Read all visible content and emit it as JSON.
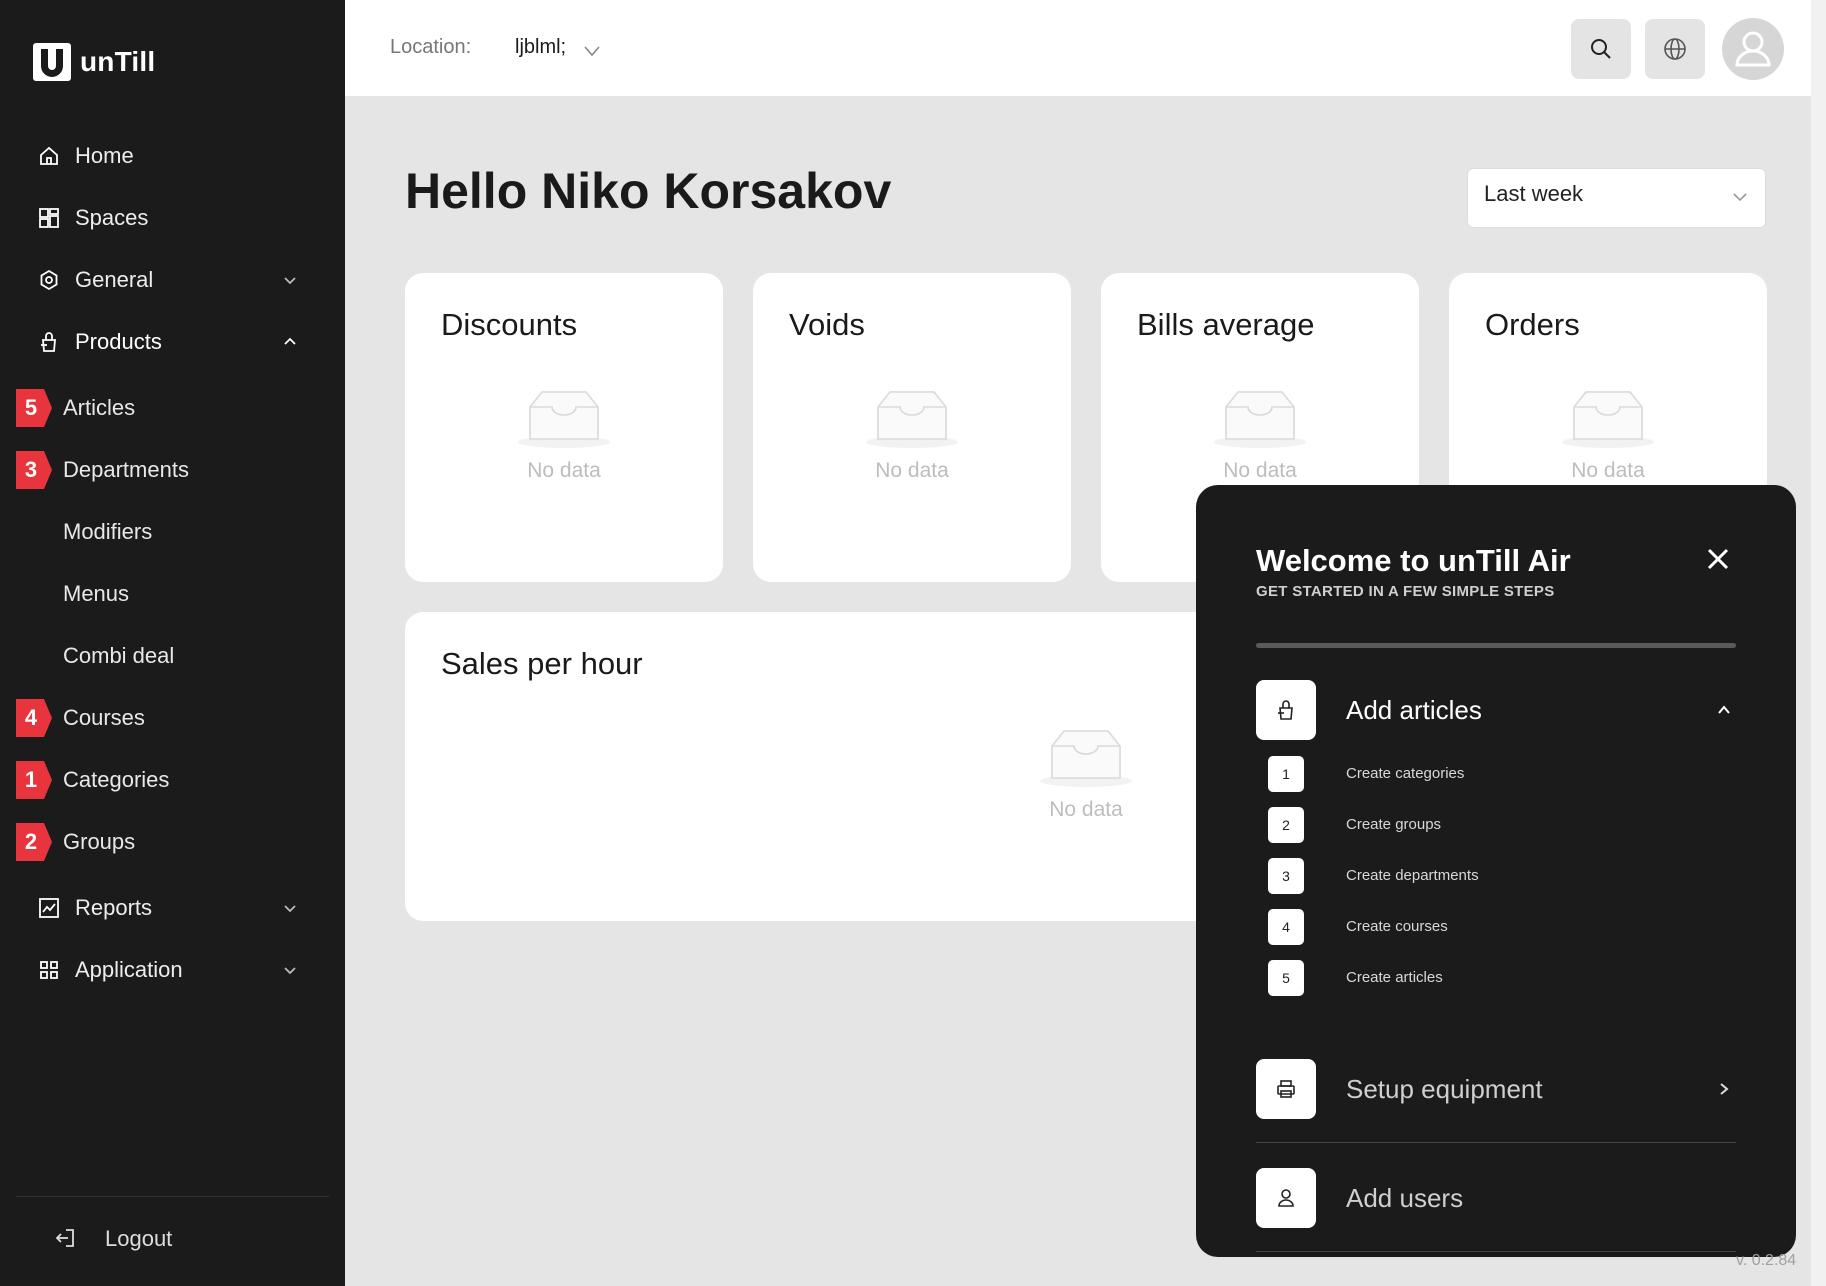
{
  "app": {
    "brand": "unTill",
    "version": "v. 0.2.84"
  },
  "sidebar": {
    "items": [
      {
        "label": "Home",
        "icon": "home-icon"
      },
      {
        "label": "Spaces",
        "icon": "spaces-icon"
      },
      {
        "label": "General",
        "icon": "general-icon",
        "chevron": "down"
      },
      {
        "label": "Products",
        "icon": "products-icon",
        "chevron": "up"
      }
    ],
    "product_subitems": [
      {
        "label": "Articles",
        "badge": "5"
      },
      {
        "label": "Departments",
        "badge": "3"
      },
      {
        "label": "Modifiers"
      },
      {
        "label": "Menus"
      },
      {
        "label": "Combi deal"
      },
      {
        "label": "Courses",
        "badge": "4"
      },
      {
        "label": "Categories",
        "badge": "1"
      },
      {
        "label": "Groups",
        "badge": "2"
      }
    ],
    "bottom_items": [
      {
        "label": "Reports",
        "icon": "reports-icon",
        "chevron": "down"
      },
      {
        "label": "Application",
        "icon": "application-icon",
        "chevron": "down"
      }
    ],
    "logout_label": "Logout"
  },
  "topbar": {
    "location_label": "Location:",
    "location_value": "ljblml;"
  },
  "main": {
    "greeting": "Hello Niko Korsakov",
    "period": "Last week",
    "cards": [
      {
        "title": "Discounts",
        "empty": "No data"
      },
      {
        "title": "Voids",
        "empty": "No data"
      },
      {
        "title": "Bills average",
        "empty": "No data"
      },
      {
        "title": "Orders",
        "empty": "No data"
      }
    ],
    "sales": {
      "title": "Sales per hour",
      "empty": "No data"
    }
  },
  "onboarding": {
    "title": "Welcome to unTill Air",
    "subtitle": "GET STARTED IN A FEW SIMPLE STEPS",
    "steps": [
      {
        "label": "Add articles",
        "expanded": true,
        "substeps": [
          {
            "num": "1",
            "label": "Create categories"
          },
          {
            "num": "2",
            "label": "Create groups"
          },
          {
            "num": "3",
            "label": "Create departments"
          },
          {
            "num": "4",
            "label": "Create courses"
          },
          {
            "num": "5",
            "label": "Create articles"
          }
        ]
      },
      {
        "label": "Setup equipment"
      },
      {
        "label": "Add users"
      }
    ]
  },
  "colors": {
    "sidebar_bg": "#1b1b1b",
    "badge_red": "#e8343c",
    "page_bg": "#e5e5e5"
  }
}
